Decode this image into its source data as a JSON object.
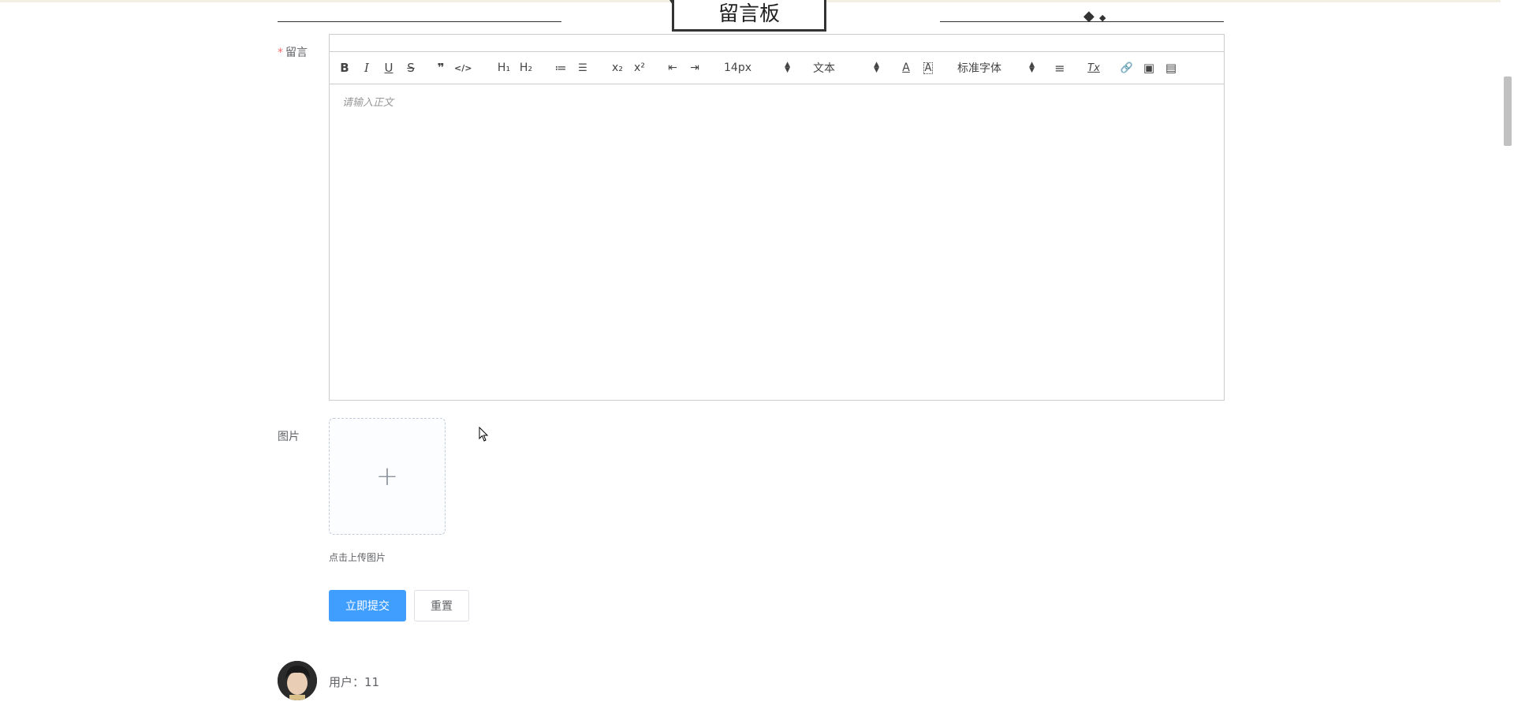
{
  "board": {
    "title": "留言板"
  },
  "form": {
    "message_label": "留言",
    "required_mark": "*",
    "image_label": "图片",
    "editor_placeholder": "请输入正文",
    "upload_tip": "点击上传图片",
    "upload_plus": "+",
    "submit_label": "立即提交",
    "reset_label": "重置"
  },
  "toolbar": {
    "bold": "B",
    "italic": "I",
    "underline": "U",
    "strike": "S",
    "quote": "❞",
    "code": "</>",
    "h1": "H₁",
    "h2": "H₂",
    "ordered_list": "≔",
    "bullet_list": "☰",
    "subscript": "x₂",
    "superscript": "x²",
    "outdent": "⇤",
    "indent": "⇥",
    "size_value": "14px",
    "header_value": "文本",
    "font_value": "标准字体",
    "align": "≡",
    "clean": "Tx",
    "link": "🔗",
    "image": "▣",
    "video": "▤"
  },
  "user": {
    "label": "用户：11"
  },
  "colors": {
    "primary": "#409eff",
    "required": "#f56c6c",
    "label": "#606266"
  }
}
